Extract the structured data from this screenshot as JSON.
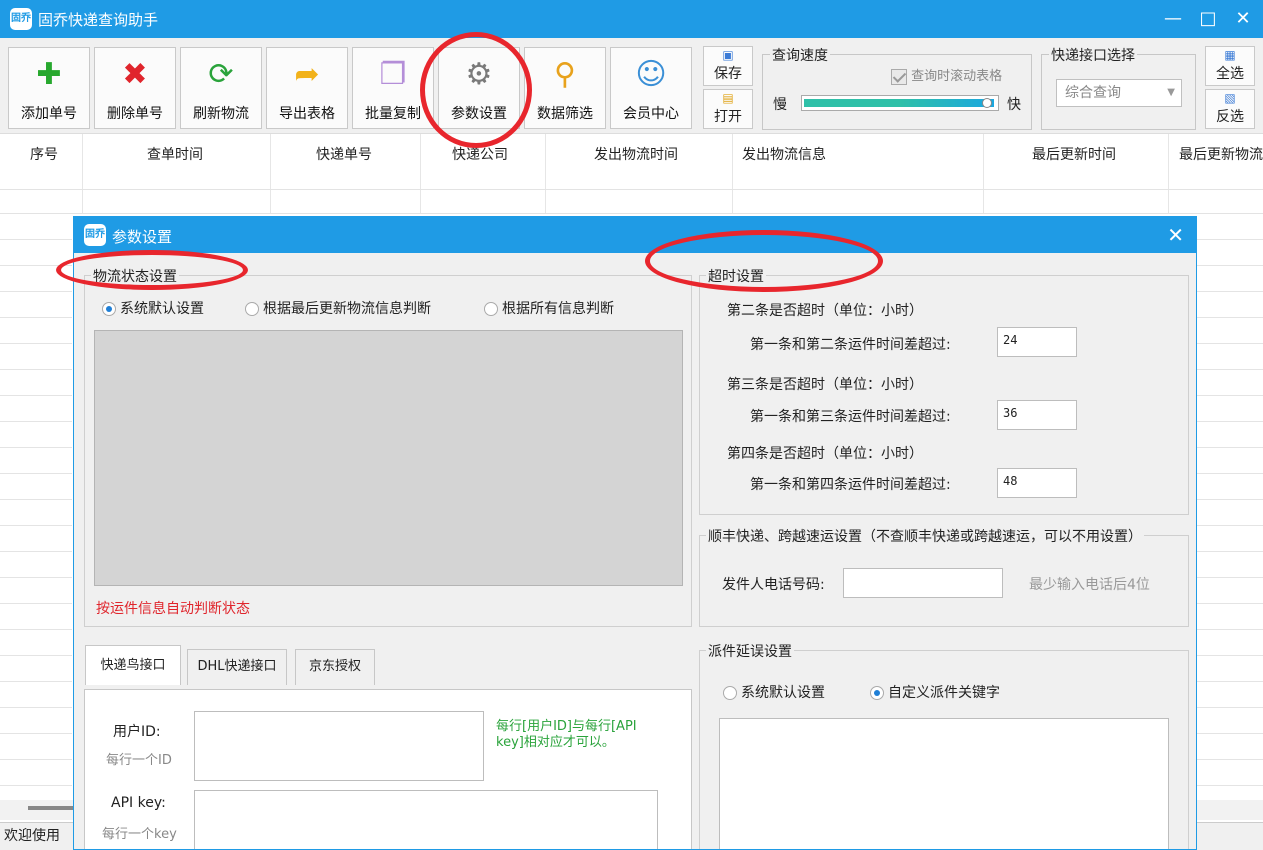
{
  "app": {
    "title": "固乔快递查询助手",
    "icon_label": "固乔"
  },
  "window_controls": {
    "minimize": "—",
    "maximize": "□",
    "close": "✕"
  },
  "toolbar": {
    "buttons": [
      {
        "label": "添加单号",
        "icon": "add-plus-icon",
        "glyph": "✚",
        "color": "#27a82e"
      },
      {
        "label": "删除单号",
        "icon": "delete-x-icon",
        "glyph": "✖",
        "color": "#e0252c"
      },
      {
        "label": "刷新物流",
        "icon": "refresh-icon",
        "glyph": "⟳",
        "color": "#2aa33b"
      },
      {
        "label": "导出表格",
        "icon": "export-folder-icon",
        "glyph": "➦",
        "color": "#f2b21a"
      },
      {
        "label": "批量复制",
        "icon": "copy-docs-icon",
        "glyph": "❐",
        "color": "#b48ed8"
      },
      {
        "label": "参数设置",
        "icon": "gear-icon",
        "glyph": "⚙",
        "color": "#7a7a7a"
      },
      {
        "label": "数据筛选",
        "icon": "magnifier-filter-icon",
        "glyph": "⚲",
        "color": "#e8a21c"
      },
      {
        "label": "会员中心",
        "icon": "members-icon",
        "glyph": "☺",
        "color": "#3a8fd6"
      }
    ],
    "save_label": "保存",
    "open_label": "打开",
    "speed": {
      "title": "查询速度",
      "scroll_label": "查询时滚动表格",
      "slow": "慢",
      "fast": "快"
    },
    "api": {
      "title": "快递接口选择",
      "selected": "综合查询"
    },
    "select_all": "全选",
    "invert_select": "反选"
  },
  "table": {
    "columns": [
      "序号",
      "查单时间",
      "快递单号",
      "快递公司",
      "发出物流时间",
      "发出物流信息",
      "最后更新时间",
      "最后更新物流"
    ]
  },
  "status": {
    "text": "欢迎使用"
  },
  "dialog": {
    "title": "参数设置",
    "icon_label": "固乔",
    "close": "✕",
    "logistics": {
      "title": "物流状态设置",
      "options": [
        "系统默认设置",
        "根据最后更新物流信息判断",
        "根据所有信息判断"
      ],
      "selected_index": 0,
      "note": "按运件信息自动判断状态"
    },
    "timeout": {
      "title": "超时设置",
      "groups": [
        {
          "heading": "第二条是否超时（单位：小时）",
          "label": "第一条和第二条运件时间差超过:",
          "value": "24"
        },
        {
          "heading": "第三条是否超时（单位：小时）",
          "label": "第一条和第三条运件时间差超过:",
          "value": "36"
        },
        {
          "heading": "第四条是否超时（单位：小时）",
          "label": "第一条和第四条运件时间差超过:",
          "value": "48"
        }
      ]
    },
    "sf": {
      "title": "顺丰快递、跨越速运设置（不查顺丰快递或跨越速运，可以不用设置）",
      "phone_label": "发件人电话号码:",
      "phone_value": "",
      "hint": "最少输入电话后4位"
    },
    "tabs": [
      "快递鸟接口",
      "DHL快递接口",
      "京东授权"
    ],
    "kdn": {
      "user_id_label": "用户ID:",
      "user_id_sub": "每行一个ID",
      "api_key_label": "API key:",
      "api_key_sub": "每行一个key",
      "note": "每行[用户ID]与每行[API key]相对应才可以。"
    },
    "delay": {
      "title": "派件延误设置",
      "options": [
        "系统默认设置",
        "自定义派件关键字"
      ],
      "selected_index": 1
    }
  }
}
